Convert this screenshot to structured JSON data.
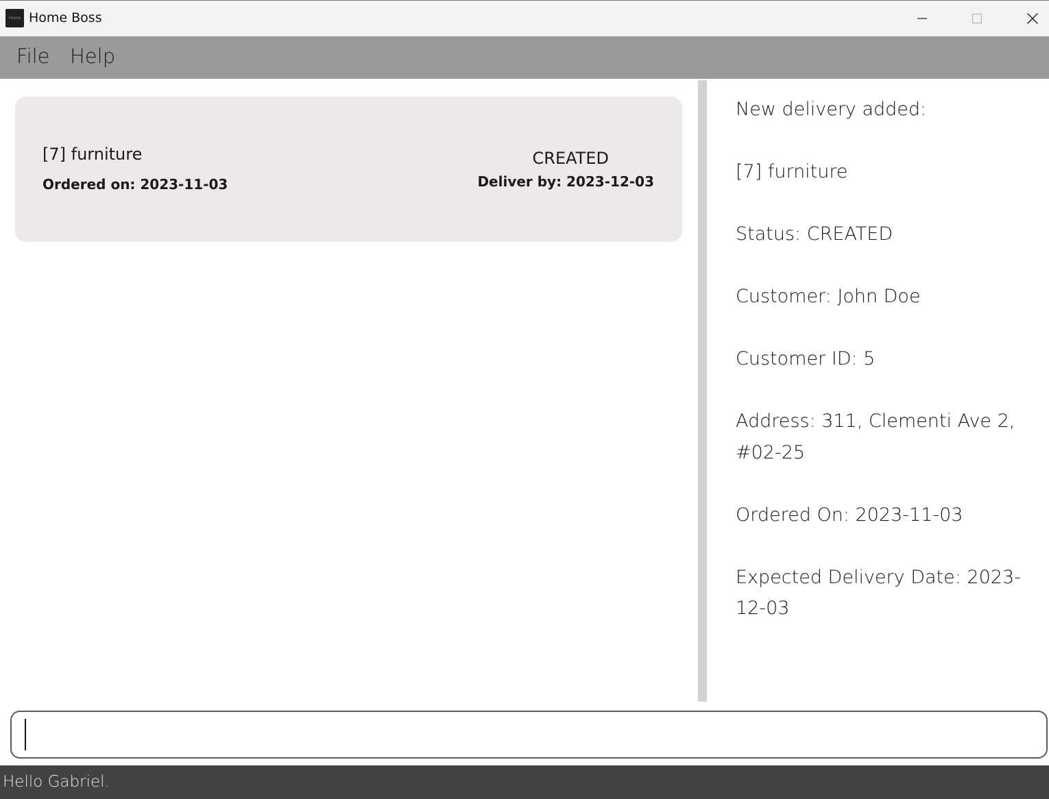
{
  "window": {
    "title": "Home Boss",
    "icon_text": "Home",
    "controls": [
      "minimize-icon",
      "maximize-icon",
      "close-icon"
    ]
  },
  "menu": {
    "items": [
      {
        "label": "File"
      },
      {
        "label": "Help"
      }
    ]
  },
  "delivery_list": {
    "items": [
      {
        "name": "[7] furniture",
        "ordered": "Ordered on: 2023-11-03",
        "status": "CREATED",
        "deliver_by": "Deliver by: 2023-12-03"
      }
    ]
  },
  "result": {
    "lines": [
      "New delivery added:",
      "[7] furniture",
      "Status: CREATED",
      "Customer: John Doe",
      "Customer ID: 5",
      "Address: 311, Clementi Ave 2, #02-25",
      "Ordered On: 2023-11-03",
      "Expected Delivery Date: 2023-12-03"
    ]
  },
  "command": {
    "value": "",
    "placeholder": ""
  },
  "status_bar": {
    "message": "Hello Gabriel."
  },
  "colors": {
    "menubar_bg": "#9a9a9a",
    "card_bg": "#efe8e8",
    "statusbar_bg": "#424242",
    "divider": "#d2d2d2"
  }
}
